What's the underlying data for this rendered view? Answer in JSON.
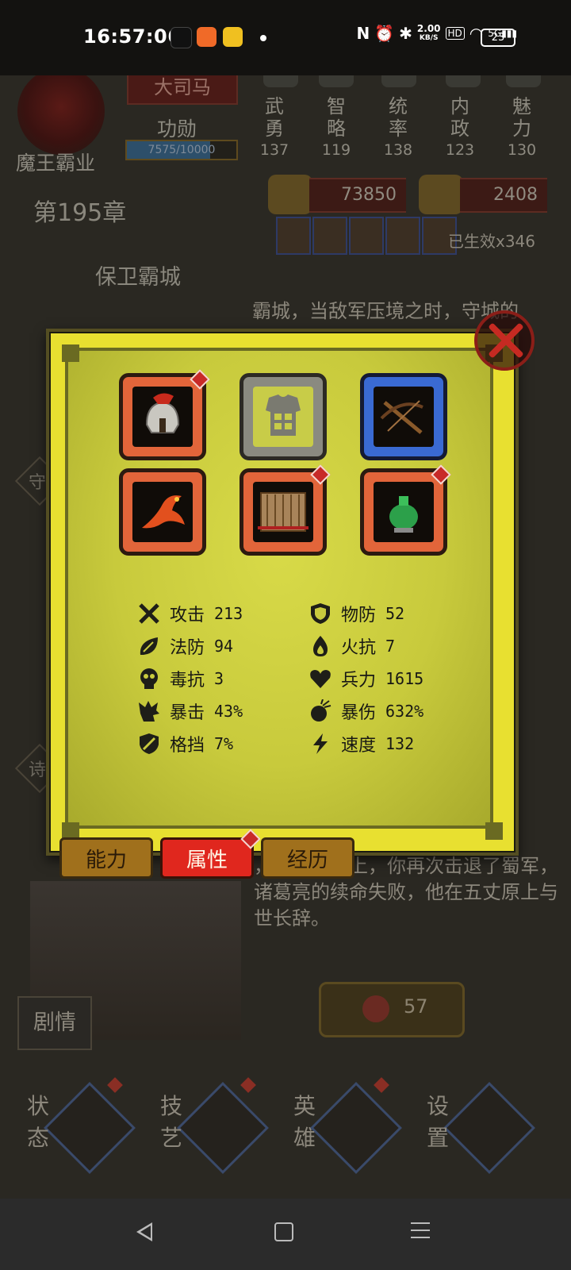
{
  "status_bar": {
    "time": "16:57:06",
    "net_speed_value": "2.00",
    "net_speed_unit": "KB/S",
    "nfc_label": "N",
    "hd_label": "HD",
    "network_label": "5G",
    "battery": "23"
  },
  "hero": {
    "name": "魔王霸业",
    "rank": "大司马",
    "merit_label": "功勋",
    "merit_text": "7575/10000",
    "merit_fraction": 0.7575
  },
  "stats": [
    {
      "name": "武勇",
      "value": "137"
    },
    {
      "name": "智略",
      "value": "119"
    },
    {
      "name": "统率",
      "value": "138"
    },
    {
      "name": "内政",
      "value": "123"
    },
    {
      "name": "魅力",
      "value": "130"
    }
  ],
  "chapter": {
    "number": "第195章",
    "title": "保卫霸城"
  },
  "resources": {
    "coins": "73850",
    "grain": "2408"
  },
  "effect_text": "已生效x346",
  "story": {
    "top_line": "霸城，当敌军压境之时，守城的",
    "body": "，在五丈原上，你再次击退了蜀军，诸葛亮的续命失败，他在五丈原上与世长辞。",
    "button": "剧情",
    "cost": "57"
  },
  "side_labels": [
    "守",
    "诗"
  ],
  "bottom_nav": [
    {
      "label": "状态"
    },
    {
      "label": "技艺"
    },
    {
      "label": "英雄"
    },
    {
      "label": "设置"
    }
  ],
  "modal": {
    "equipment": [
      {
        "name": "helmet-icon",
        "rarity": "orange",
        "has_badge": true
      },
      {
        "name": "armor-icon",
        "rarity": "gray",
        "has_badge": false
      },
      {
        "name": "crossbow-icon",
        "rarity": "blue",
        "has_badge": false
      },
      {
        "name": "phoenix-icon",
        "rarity": "orange",
        "has_badge": false
      },
      {
        "name": "scroll-icon",
        "rarity": "orange",
        "has_badge": true
      },
      {
        "name": "jade-jar-icon",
        "rarity": "orange",
        "has_badge": true
      }
    ],
    "attributes": [
      {
        "icon": "attack-icon",
        "name": "攻击",
        "value": "213"
      },
      {
        "icon": "phys-def-icon",
        "name": "物防",
        "value": "52"
      },
      {
        "icon": "magic-def-icon",
        "name": "法防",
        "value": "94"
      },
      {
        "icon": "fire-res-icon",
        "name": "火抗",
        "value": "7"
      },
      {
        "icon": "poison-res-icon",
        "name": "毒抗",
        "value": "3"
      },
      {
        "icon": "troops-icon",
        "name": "兵力",
        "value": "1615"
      },
      {
        "icon": "crit-icon",
        "name": "暴击",
        "value": "43%"
      },
      {
        "icon": "crit-dmg-icon",
        "name": "暴伤",
        "value": "632%"
      },
      {
        "icon": "block-icon",
        "name": "格挡",
        "value": "7%"
      },
      {
        "icon": "speed-icon",
        "name": "速度",
        "value": "132"
      }
    ],
    "tabs": [
      {
        "label": "能力",
        "active": false
      },
      {
        "label": "属性",
        "active": true
      },
      {
        "label": "经历",
        "active": false
      }
    ]
  }
}
